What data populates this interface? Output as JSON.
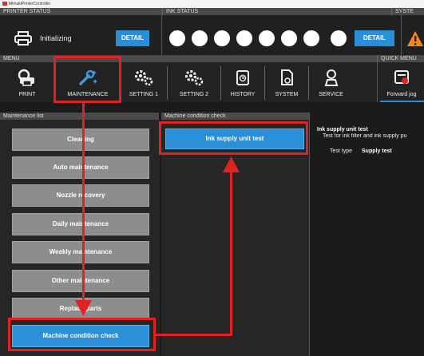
{
  "window": {
    "title": "MimakiPrinterController"
  },
  "printer_status": {
    "header": "PRINTER STATUS",
    "state": "Initializing",
    "detail_label": "DETAIL"
  },
  "ink_status": {
    "header": "INK STATUS",
    "detail_label": "DETAIL",
    "ink_slots": 8
  },
  "system_status": {
    "header": "SYSTE"
  },
  "menu": {
    "header": "MENU",
    "items": [
      {
        "label": "PRINT",
        "icon": "printer-icon"
      },
      {
        "label": "MAINTENANCE",
        "icon": "wrench-sparkle-icon"
      },
      {
        "label": "SETTING 1",
        "icon": "gears-icon"
      },
      {
        "label": "SETTING 2",
        "icon": "gears-icon"
      },
      {
        "label": "HISTORY",
        "icon": "history-icon"
      },
      {
        "label": "SYSTEM",
        "icon": "system-icon"
      },
      {
        "label": "SERVICE",
        "icon": "service-icon"
      }
    ]
  },
  "quick_menu": {
    "header": "QUICK MENU",
    "item_label": "Forward jog"
  },
  "maintenance_list": {
    "header": "Maintenance list",
    "items": [
      "Cleaning",
      "Auto maintenance",
      "Nozzle recovery",
      "Daily maintenance",
      "Weekly maintenance",
      "Other maintenance",
      "Replace parts",
      "Machine condition check"
    ],
    "selected": "Machine condition check"
  },
  "machine_check": {
    "header": "Machine condition check",
    "items": [
      "Ink supply unit test"
    ]
  },
  "detail": {
    "title": "Ink supply unit test",
    "description": "Test for ink filter and ink supply pu",
    "field_label": "Test type",
    "field_value": "Supply test"
  },
  "colors": {
    "accent": "#2b8fd8",
    "highlight": "#e02222",
    "list_button": "#8d8d8d"
  }
}
